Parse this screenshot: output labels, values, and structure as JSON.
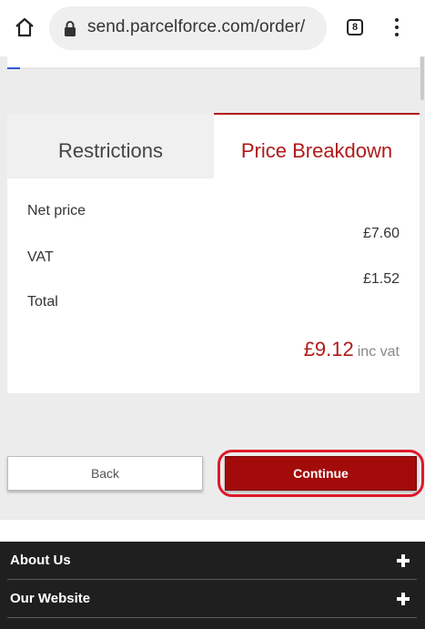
{
  "browser": {
    "url": "send.parcelforce.com/order/",
    "tab_count": "8"
  },
  "tabs": [
    {
      "label": "Restrictions",
      "active": false
    },
    {
      "label": "Price Breakdown",
      "active": true
    }
  ],
  "price_breakdown": {
    "net_price_label": "Net price",
    "net_price_value": "£7.60",
    "vat_label": "VAT",
    "vat_value": "£1.52",
    "total_label": "Total",
    "total_value": "£9.12",
    "total_suffix": "inc vat"
  },
  "actions": {
    "back_label": "Back",
    "continue_label": "Continue"
  },
  "footer": {
    "items": [
      {
        "label": "About Us"
      },
      {
        "label": "Our Website"
      }
    ]
  },
  "colors": {
    "brand_red": "#b01a1a",
    "continue_bg": "#a30b0b",
    "highlight_ring": "#e0182a",
    "footer_bg": "#1f1f1f"
  }
}
